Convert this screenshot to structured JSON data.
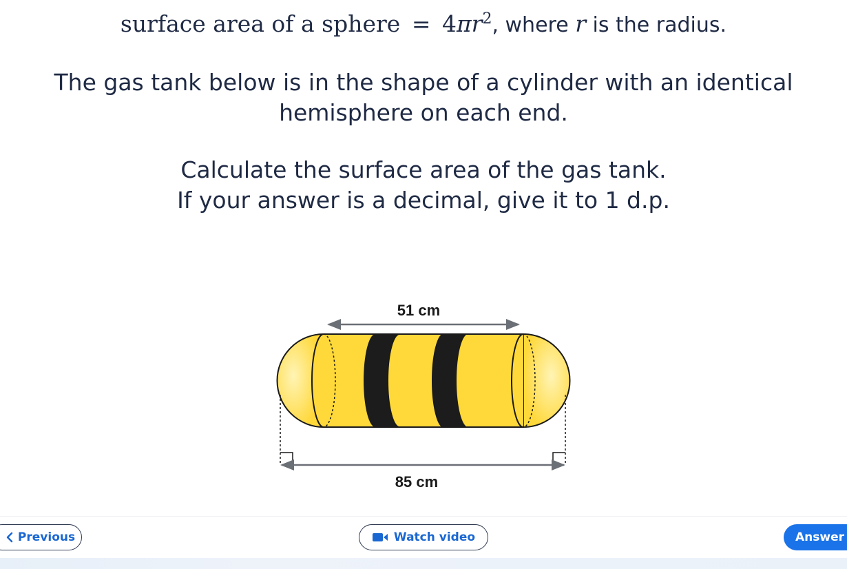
{
  "formula": {
    "prefix": "surface area of a sphere",
    "equals": "=",
    "coef": "4",
    "pi": "π",
    "var": "r",
    "exp": "2",
    "mid": ", where ",
    "var2": "r",
    "suffix": " is the radius."
  },
  "question": {
    "line1": "The gas tank below is in the shape of a cylinder with an identical",
    "line2": "hemisphere on each end.",
    "line3": "Calculate the surface area of the gas tank.",
    "line4": "If your answer is a decimal, give it to 1 d.p."
  },
  "diagram": {
    "top_label": "51 cm",
    "bottom_label": "85 cm",
    "colors": {
      "yellow": "#ffd83a",
      "yellow_light": "#fff2a8",
      "band": "#1c1c1c",
      "outline": "#1a1a1a",
      "arrow": "#6b6f76"
    }
  },
  "footer": {
    "previous_label": "Previous",
    "video_label": "Watch video",
    "answer_label": "Answer",
    "accent": "#1a73e8"
  }
}
